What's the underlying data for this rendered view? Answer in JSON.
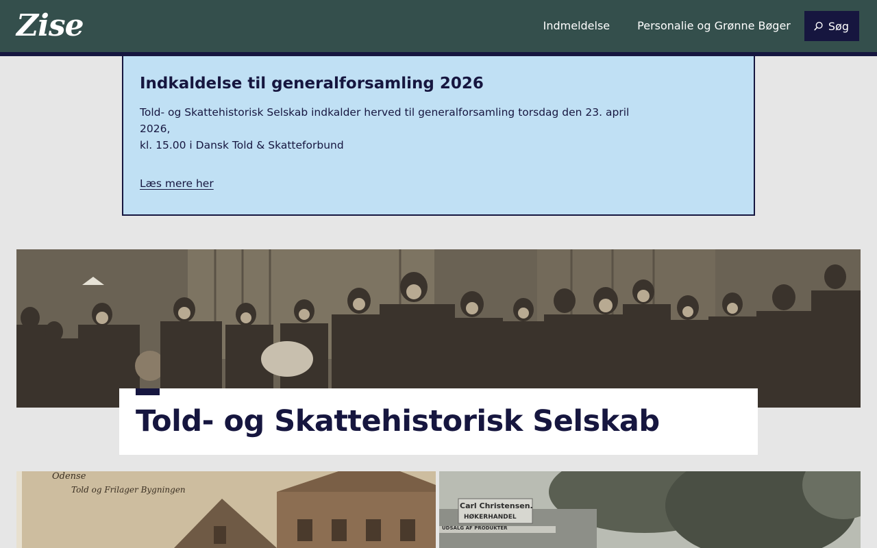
{
  "header": {
    "logo": "Zise",
    "nav": [
      "Indmeldelse",
      "Personalie og Grønne Bøger"
    ],
    "search_label": "Søg",
    "search_icon": "search-icon"
  },
  "notice": {
    "title": "Indkaldelse til generalforsamling 2026",
    "body_line1": "Told- og Skattehistorisk Selskab indkalder herved til generalforsamling torsdag den 23. april 2026,",
    "body_line2": "kl. 15.00 i Dansk Told & Skatteforbund",
    "link": "Læs mere her"
  },
  "hero": {
    "title": "Told- og Skattehistorisk Selskab"
  },
  "photos": {
    "left_caption_1": "Odense",
    "left_caption_2": "Told og Frilager Bygningen",
    "right_sign_1": "Carl Christensen.",
    "right_sign_2": "HØKERHANDEL",
    "right_sign_3": "UDSALG AF PRODUKTER"
  },
  "colors": {
    "header_bg": "#344f4c",
    "accent": "#16163f",
    "notice_bg": "#c0e0f4",
    "page_bg": "#e6e6e6"
  }
}
